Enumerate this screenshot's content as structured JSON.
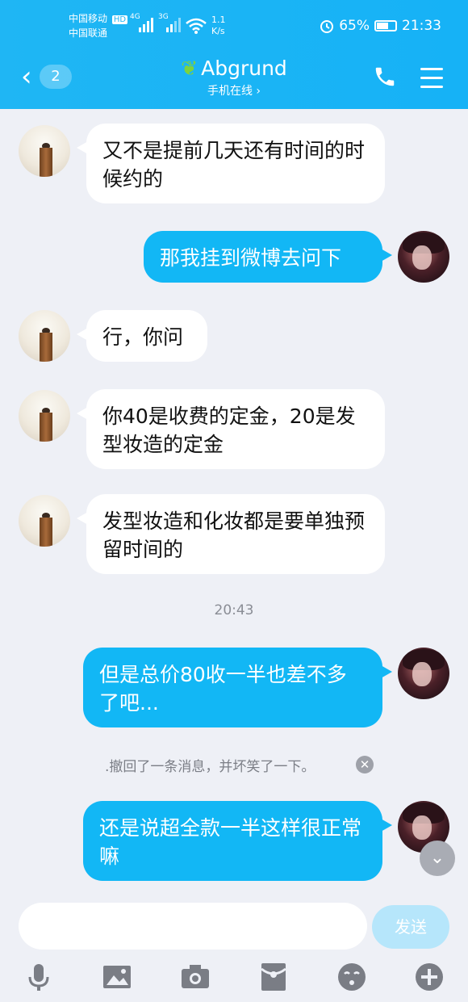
{
  "status_bar": {
    "carrier_1": "中国移动",
    "carrier_1_badge": "HD",
    "carrier_2": "中国联通",
    "net_1": "4G",
    "net_2": "3G",
    "speed_value": "1.1",
    "speed_unit": "K/s",
    "battery": "65%",
    "battery_level": 0.65,
    "time": "21:33"
  },
  "header": {
    "back_badge": "2",
    "title": "Abgrund",
    "subtitle": "手机在线 ›",
    "icons": [
      "back-chevron-icon",
      "sprout-icon",
      "phone-icon",
      "menu-icon"
    ]
  },
  "messages": [
    {
      "side": "in",
      "text": "又不是提前几天还有时间的时候约的"
    },
    {
      "side": "out",
      "text": "那我挂到微博去问下"
    },
    {
      "side": "in",
      "text": "行，你问"
    },
    {
      "side": "in",
      "text": "你40是收费的定金，20是发型妆造的定金"
    },
    {
      "side": "in",
      "text": "发型妆造和化妆都是要单独预留时间的"
    },
    {
      "side": "out",
      "text": "但是总价80收一半也差不多了吧..."
    },
    {
      "side": "out",
      "text": "还是说超全款一半这样很正常嘛"
    }
  ],
  "timestamp": "20:43",
  "system_message": ".撤回了一条消息，并坏笑了一下。",
  "input": {
    "placeholder": "",
    "send_label": "发送"
  },
  "toolbar": {
    "icons": [
      "mic-icon",
      "image-icon",
      "camera-icon",
      "red-packet-icon",
      "emoji-icon",
      "plus-icon"
    ]
  },
  "colors": {
    "header": "#1fb6f4",
    "out_bubble": "#12b7f5",
    "in_bubble": "#ffffff",
    "background": "#eef0f6"
  }
}
